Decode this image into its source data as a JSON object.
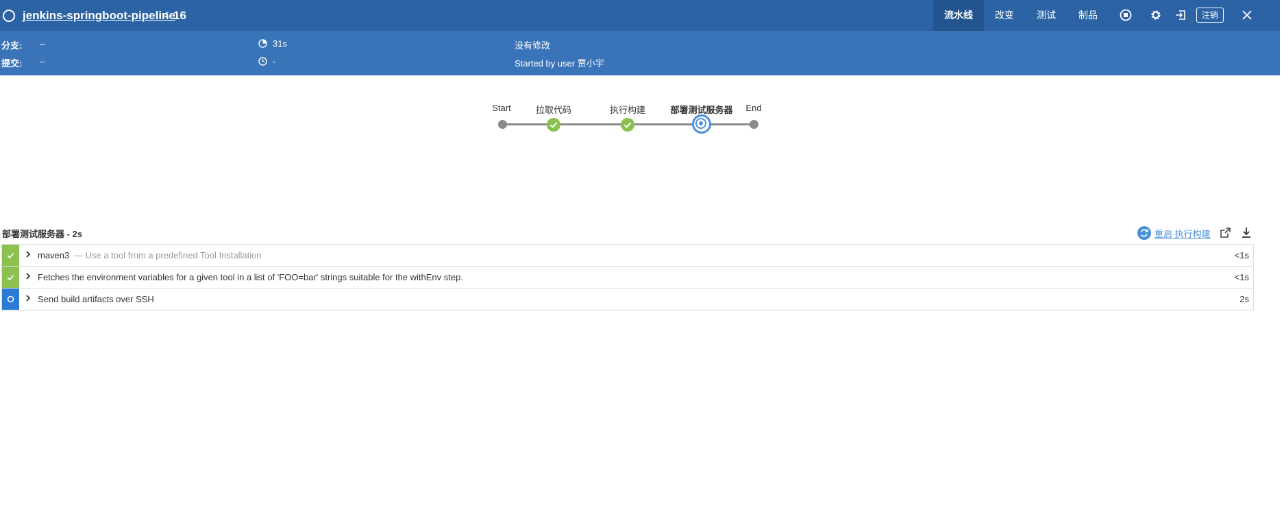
{
  "header": {
    "pipeline_name": "jenkins-springboot-pipeline",
    "back_symbol": "<",
    "run_number": "16",
    "tabs": [
      "流水线",
      "改变",
      "测试",
      "制品"
    ],
    "logout_label": "注销",
    "icons": [
      "status-ring-icon",
      "stop-icon",
      "gear-icon",
      "exit-icon",
      "close-icon"
    ]
  },
  "run_info": {
    "branch_label": "分支:",
    "branch_value": "–",
    "commit_label": "提交:",
    "commit_value": "–",
    "duration": "31s",
    "time": "-",
    "changes": "没有修改",
    "started_by": "Started by user 贾小宇"
  },
  "graph": {
    "stages": [
      {
        "label": "Start",
        "status": "node"
      },
      {
        "label": "拉取代码",
        "status": "success"
      },
      {
        "label": "执行构建",
        "status": "success"
      },
      {
        "label": "部署测试服务器",
        "status": "running"
      },
      {
        "label": "End",
        "status": "node"
      }
    ]
  },
  "stage_detail": {
    "title": "部署测试服务器 - 2s",
    "restart_label": "重启 执行构建",
    "steps": [
      {
        "title": "maven3",
        "description": "— Use a tool from a predefined Tool Installation",
        "duration": "<1s",
        "status": "success"
      },
      {
        "title": "Fetches the environment variables for a given tool in a list of 'FOO=bar' strings suitable for the withEnv step.",
        "description": "",
        "duration": "<1s",
        "status": "success"
      },
      {
        "title": "Send build artifacts over SSH",
        "description": "",
        "duration": "2s",
        "status": "running"
      }
    ]
  },
  "colors": {
    "header_bg": "#2c63a4",
    "subheader_bg": "#3a74b8",
    "success": "#8cc04f",
    "running": "#2b7ad6",
    "link": "#4a90d9"
  }
}
